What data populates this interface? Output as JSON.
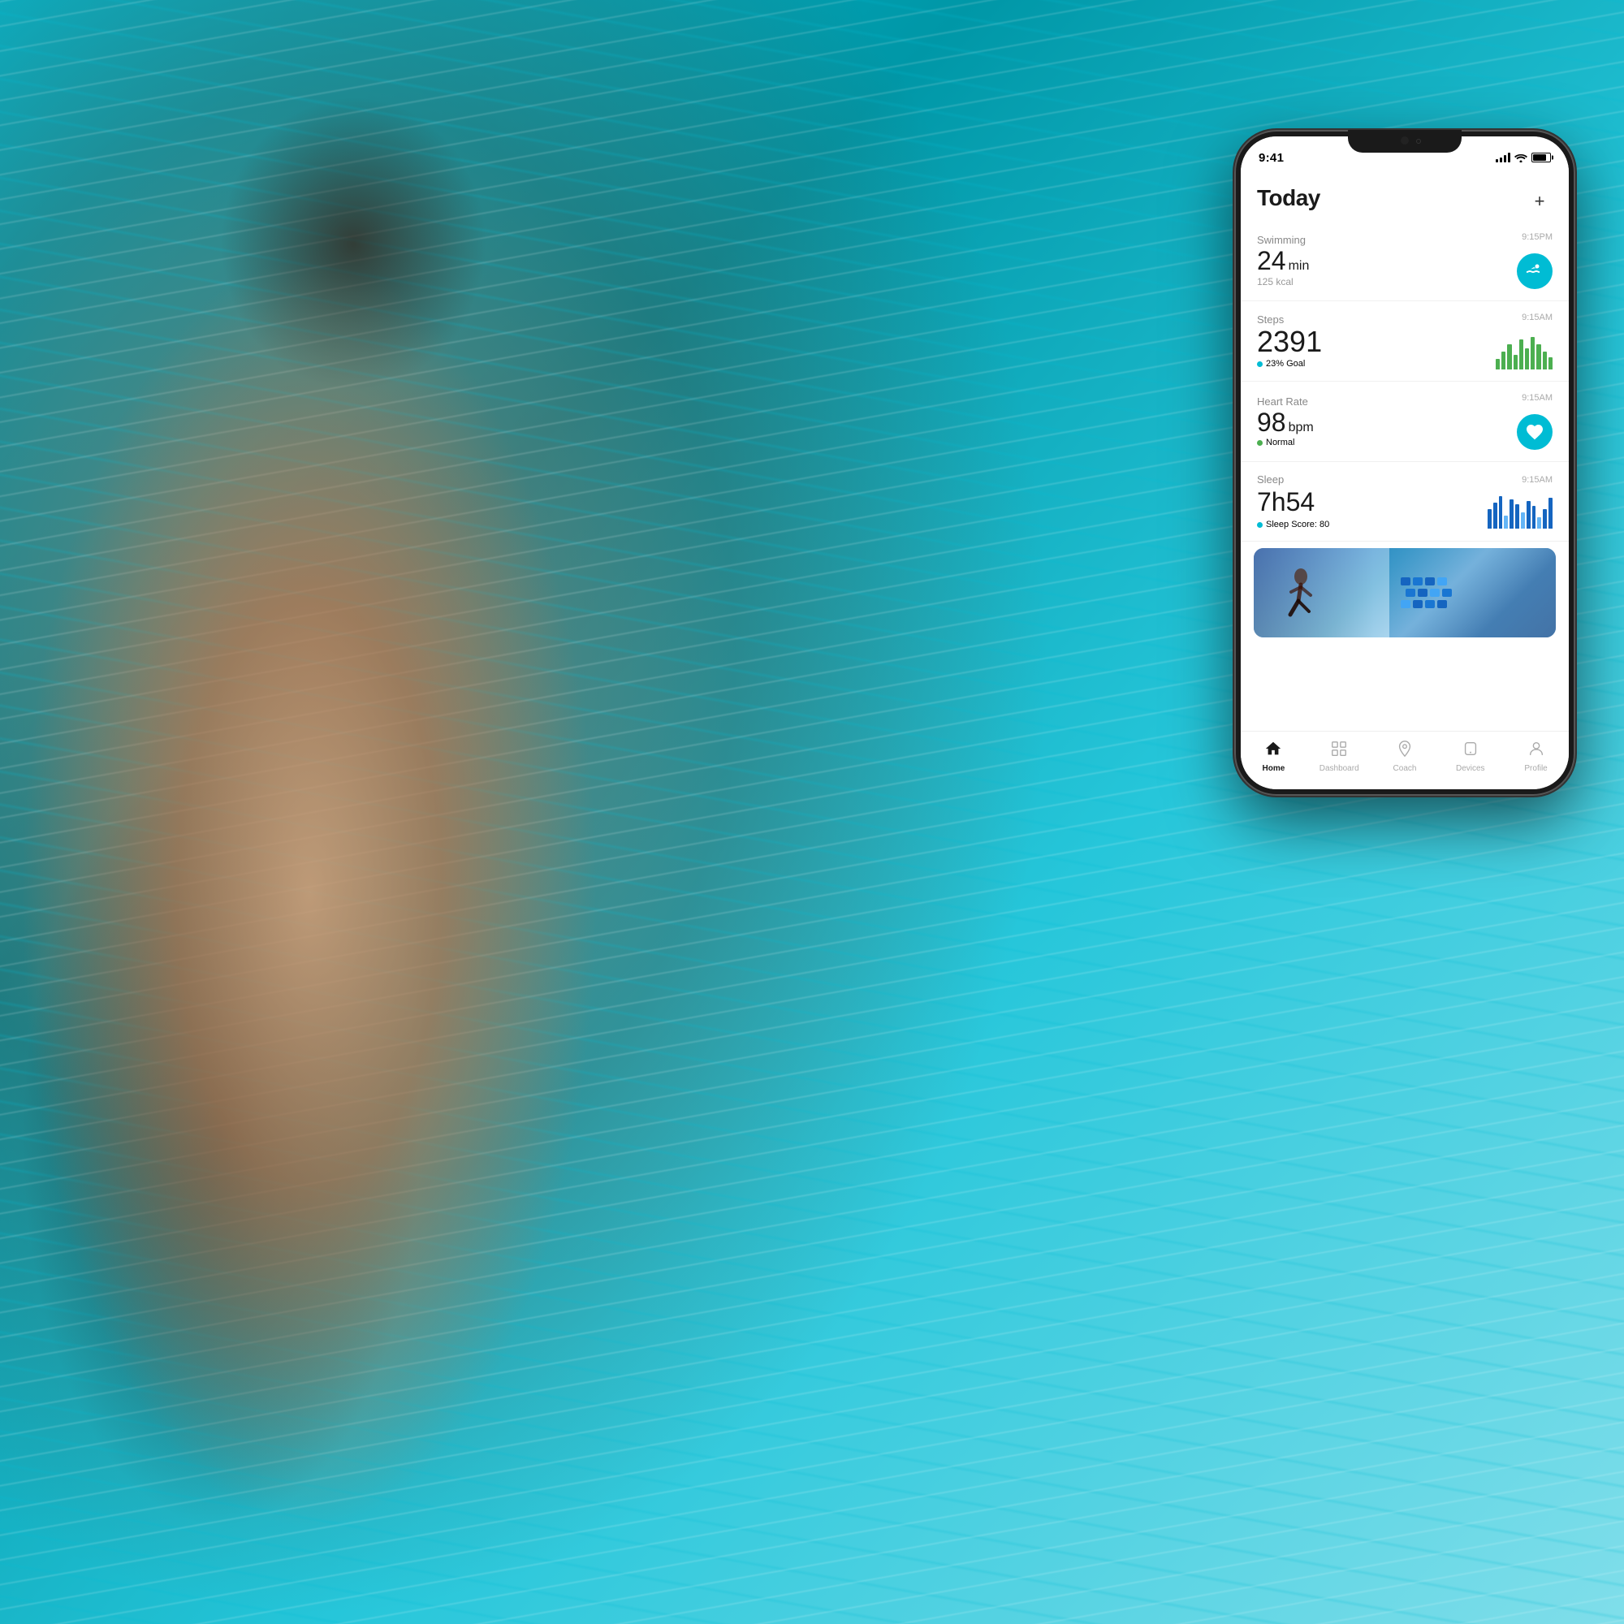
{
  "background": {
    "color_top": "#0097a7",
    "color_mid": "#26c6da",
    "color_bottom": "#00acc1"
  },
  "phone": {
    "status_bar": {
      "time": "9:41",
      "battery_level": "80"
    },
    "header": {
      "title": "Today",
      "add_button": "+"
    },
    "activities": [
      {
        "id": "swimming",
        "label": "Swimming",
        "timestamp": "9:15PM",
        "value_big": "24",
        "value_unit": "min",
        "sub": "125 kcal",
        "icon_type": "swimming",
        "icon_emoji": "🏊",
        "has_icon_circle": true,
        "icon_color": "#00BCD4"
      },
      {
        "id": "steps",
        "label": "Steps",
        "timestamp": "9:15AM",
        "value_big": "2391",
        "value_unit": "",
        "sub_dot_color": "teal",
        "sub": "23% Goal",
        "has_chart": true,
        "chart_type": "steps",
        "chart_bars": [
          3,
          5,
          7,
          4,
          8,
          6,
          9,
          7,
          5,
          3
        ]
      },
      {
        "id": "heart_rate",
        "label": "Heart Rate",
        "timestamp": "9:15AM",
        "value_big": "98",
        "value_unit": "bpm",
        "sub_dot_color": "green",
        "sub": "Normal",
        "has_icon_circle": true,
        "icon_emoji": "♥",
        "icon_color": "#00BCD4"
      },
      {
        "id": "sleep",
        "label": "Sleep",
        "timestamp": "9:15AM",
        "value_big": "7h54",
        "value_unit": "",
        "sub_dot_color": "teal",
        "sub": "Sleep Score: 80",
        "has_chart": true,
        "chart_type": "sleep"
      }
    ],
    "bottom_nav": {
      "items": [
        {
          "id": "home",
          "label": "Home",
          "active": true,
          "icon": "home"
        },
        {
          "id": "dashboard",
          "label": "Dashboard",
          "active": false,
          "icon": "dashboard"
        },
        {
          "id": "coach",
          "label": "Coach",
          "active": false,
          "icon": "coach"
        },
        {
          "id": "devices",
          "label": "Devices",
          "active": false,
          "icon": "devices"
        },
        {
          "id": "profile",
          "label": "Profile",
          "active": false,
          "icon": "profile"
        }
      ]
    }
  }
}
